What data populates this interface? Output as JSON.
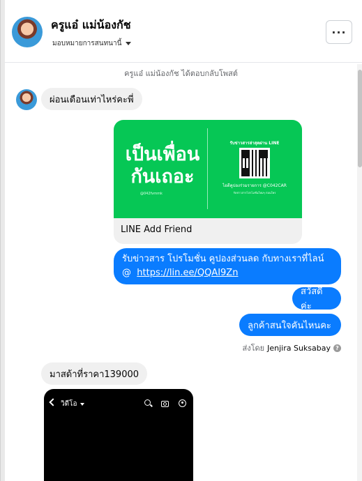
{
  "header": {
    "name": "ครูแอ๋ แม่น้องกัช",
    "subtitle": "มอบหมายการสนทนานี้",
    "more_label": "···"
  },
  "conversation": {
    "reply_note": "ครูแอ๋ แม่น้องกัช ได้ตอบกลับโพสต์",
    "messages": [
      {
        "side": "in",
        "text": "ผ่อนเดือนเท่าไหร่คะพี่"
      },
      {
        "side": "out_card",
        "card_label": "LINE Add Friend"
      },
      {
        "side": "out",
        "text_line1": "รับข่าวสาร  โปรโมชั่น คูปองส่วนลด กับทางเราที่ไลน์",
        "text_prefix": "@",
        "link": "https://lin.ee/QQAI9Zn"
      },
      {
        "side": "out",
        "text": "สวัสดีค่ะ"
      },
      {
        "side": "out",
        "text": "ลูกค้าสนใจคันไหนคะ"
      },
      {
        "side": "in",
        "text": "มาสด้าที่ราคา139000"
      }
    ],
    "sent_by_prefix": "ส่งโดย",
    "sent_by_name": "Jenjira Suksabay",
    "help_icon": "?"
  },
  "line_card": {
    "big_text_line1": "เป็นเพื่อน",
    "big_text_line2": "กันเถอะ",
    "small_id": "@042fvmmk",
    "qr_title": "รับข่าวสารล่าสุดผ่าน LINE",
    "qr_id": "ไอดีคูปองร่วมรายการ @C042CAR",
    "qr_desc": "รับข่าวสารโปรโมชั่นใหม่ๆ ก่อนใคร",
    "brand_color": "#06C755"
  },
  "phone_preview": {
    "title": "วิดีโอ",
    "icons": [
      "search-icon",
      "camera-icon",
      "profile-icon"
    ]
  },
  "colors": {
    "outgoing_bubble": "#0A7CFF",
    "incoming_bubble": "#F0F0F0"
  }
}
